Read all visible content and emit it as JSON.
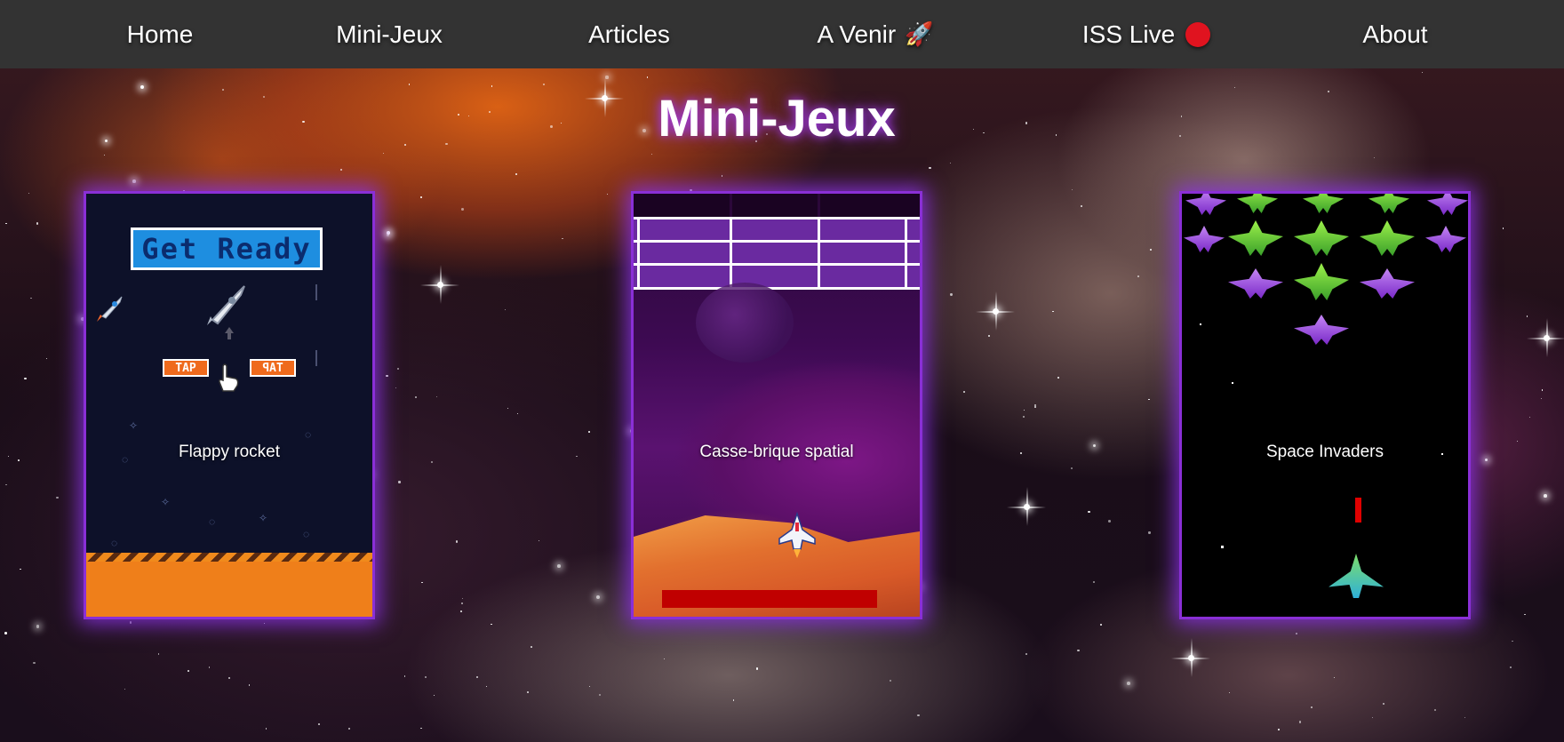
{
  "nav": {
    "items": [
      {
        "label": "Home"
      },
      {
        "label": "Mini-Jeux"
      },
      {
        "label": "Articles"
      },
      {
        "label": "A Venir",
        "emoji": "🚀"
      },
      {
        "label": "ISS Live",
        "indicator": "red-dot"
      },
      {
        "label": "About"
      }
    ]
  },
  "page": {
    "title": "Mini-Jeux"
  },
  "games": [
    {
      "label": "Flappy rocket",
      "screen": {
        "banner": "Get Ready",
        "tap_left": "TAP",
        "tap_right": "TAP"
      }
    },
    {
      "label": "Casse-brique spatial"
    },
    {
      "label": "Space Invaders"
    }
  ],
  "colors": {
    "navbar": "#333333",
    "card_glow": "#8a2fd6",
    "title_glow": "#a03ce6",
    "iss_live_dot": "#e0131f",
    "paddle": "#c00000",
    "flappy_ground": "#ef7f1a"
  }
}
